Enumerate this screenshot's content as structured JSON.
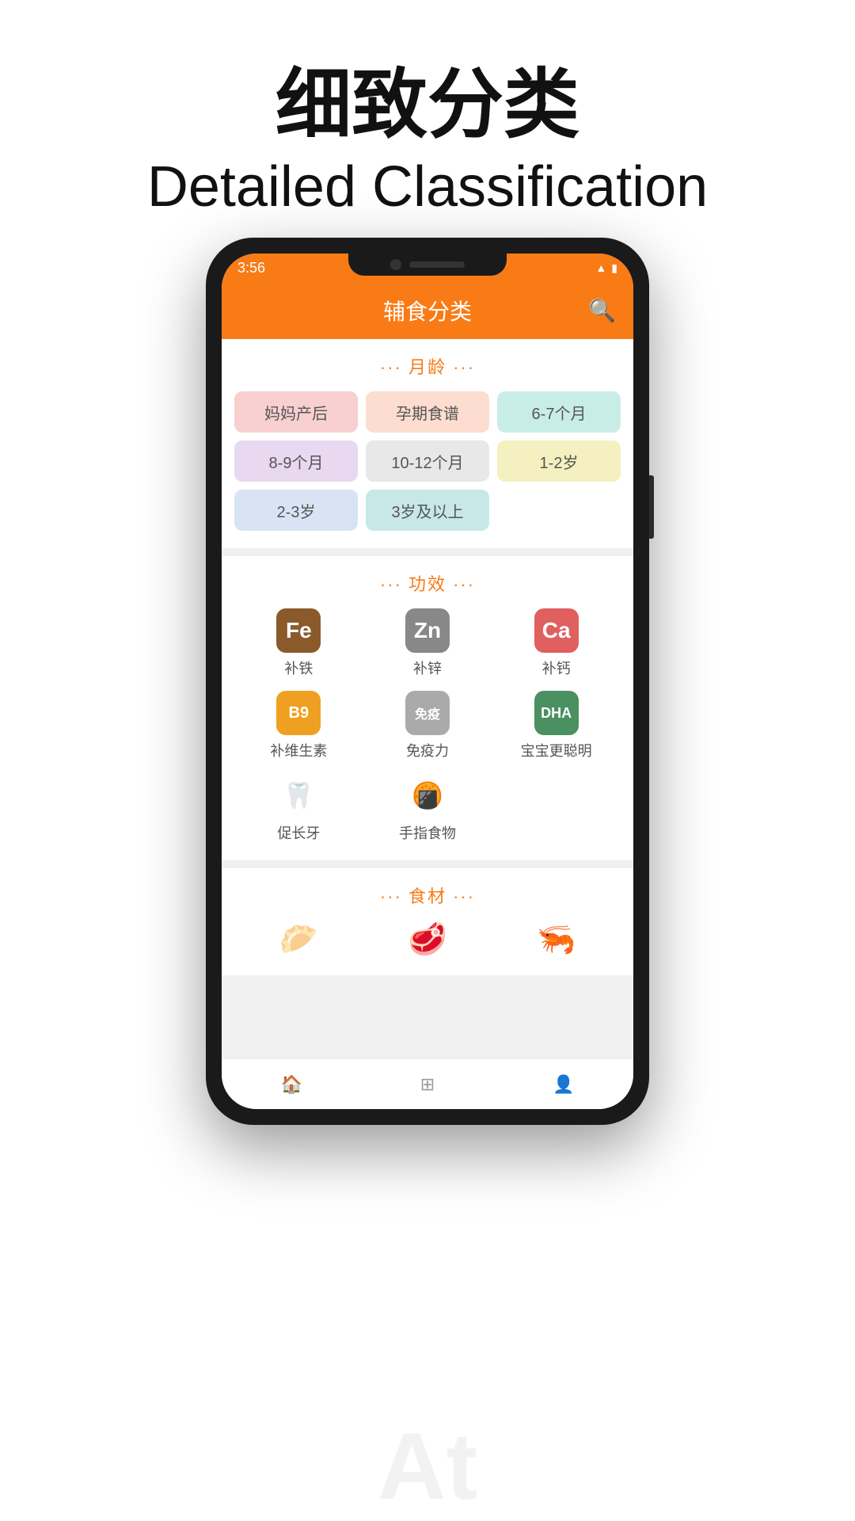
{
  "page": {
    "title_cn": "细致分类",
    "title_en": "Detailed Classification"
  },
  "status_bar": {
    "time": "3:56",
    "icons": [
      "📶",
      "🔋"
    ]
  },
  "app_header": {
    "title": "辅食分类"
  },
  "section_age": {
    "header": "··· 月龄 ···",
    "buttons": [
      {
        "label": "妈妈产后",
        "color": "pink"
      },
      {
        "label": "孕期食谱",
        "color": "peach"
      },
      {
        "label": "6-7个月",
        "color": "mint"
      },
      {
        "label": "8-9个月",
        "color": "lavender"
      },
      {
        "label": "10-12个月",
        "color": "gray"
      },
      {
        "label": "1-2岁",
        "color": "yellow"
      },
      {
        "label": "2-3岁",
        "color": "blue"
      },
      {
        "label": "3岁及以上",
        "color": "teal"
      }
    ]
  },
  "section_function": {
    "header": "··· 功效 ···",
    "items": [
      {
        "icon": "Fe",
        "label": "补铁",
        "type": "fe"
      },
      {
        "icon": "Zn",
        "label": "补锌",
        "type": "zn"
      },
      {
        "icon": "Ca",
        "label": "补钙",
        "type": "ca"
      },
      {
        "icon": "B9",
        "label": "补维生素",
        "type": "b9"
      },
      {
        "icon": "免疫",
        "label": "免疫力",
        "type": "immune"
      },
      {
        "icon": "DHA",
        "label": "宝宝更聪明",
        "type": "dha"
      },
      {
        "icon": "🦷",
        "label": "促长牙",
        "type": "tooth"
      },
      {
        "icon": "🍘",
        "label": "手指食物",
        "type": "finger"
      }
    ]
  },
  "section_food": {
    "header": "··· 食材 ···",
    "items": [
      {
        "icon": "🥟",
        "label": ""
      },
      {
        "icon": "🥩",
        "label": ""
      },
      {
        "icon": "🦐",
        "label": ""
      }
    ]
  },
  "bottom_nav": {
    "items": [
      "🏠",
      "⊞",
      "👤"
    ]
  },
  "bottom_text": "At"
}
